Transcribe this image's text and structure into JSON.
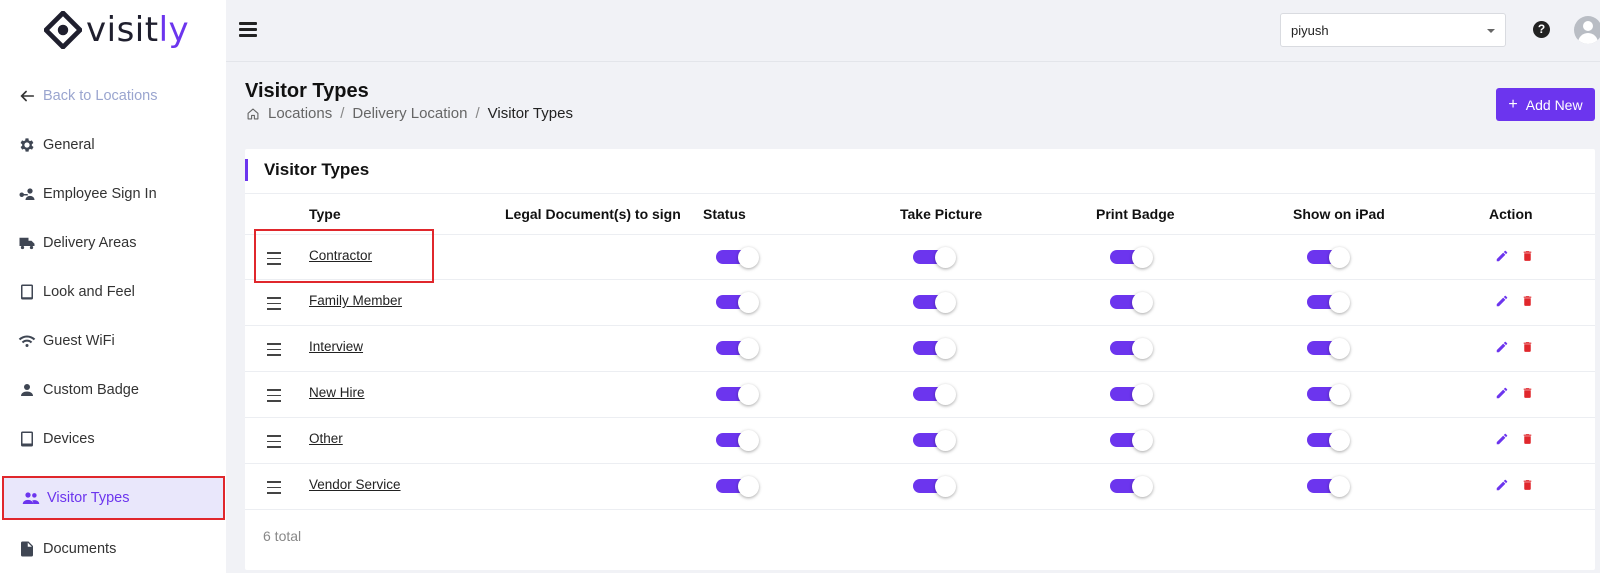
{
  "brand": {
    "name_main": "visit",
    "name_accent": "ly",
    "accent_color": "#6c35ee",
    "danger_color": "#e0272c"
  },
  "sidebar": {
    "back": {
      "label": "Back to Locations",
      "icon": "arrow-left-icon"
    },
    "items": [
      {
        "label": "General",
        "icon": "gear-icon"
      },
      {
        "label": "Employee Sign In",
        "icon": "employee-key-icon"
      },
      {
        "label": "Delivery Areas",
        "icon": "truck-icon"
      },
      {
        "label": "Look and Feel",
        "icon": "tablet-icon"
      },
      {
        "label": "Guest WiFi",
        "icon": "wifi-icon"
      },
      {
        "label": "Custom Badge",
        "icon": "person-icon"
      },
      {
        "label": "Devices",
        "icon": "tablet-icon"
      },
      {
        "label": "Visitor Types",
        "icon": "people-icon",
        "active": true
      },
      {
        "label": "Documents",
        "icon": "document-icon"
      }
    ]
  },
  "topbar": {
    "user_select": {
      "value": "piyush"
    }
  },
  "header": {
    "title": "Visitor Types",
    "breadcrumb": [
      "Locations",
      "Delivery Location",
      "Visitor Types"
    ],
    "add_button_label": "Add New"
  },
  "table": {
    "card_title": "Visitor Types",
    "columns": [
      "Type",
      "Legal Document(s) to sign",
      "Status",
      "Take Picture",
      "Print Badge",
      "Show on iPad",
      "Action"
    ],
    "rows": [
      {
        "type": "Contractor",
        "legal": "",
        "status": true,
        "take_picture": true,
        "print_badge": true,
        "show_on_ipad": true
      },
      {
        "type": "Family Member",
        "legal": "",
        "status": true,
        "take_picture": true,
        "print_badge": true,
        "show_on_ipad": true
      },
      {
        "type": "Interview",
        "legal": "",
        "status": true,
        "take_picture": true,
        "print_badge": true,
        "show_on_ipad": true
      },
      {
        "type": "New Hire",
        "legal": "",
        "status": true,
        "take_picture": true,
        "print_badge": true,
        "show_on_ipad": true
      },
      {
        "type": "Other",
        "legal": "",
        "status": true,
        "take_picture": true,
        "print_badge": true,
        "show_on_ipad": true
      },
      {
        "type": "Vendor Service",
        "legal": "",
        "status": true,
        "take_picture": true,
        "print_badge": true,
        "show_on_ipad": true
      }
    ],
    "total_label": "6 total"
  }
}
